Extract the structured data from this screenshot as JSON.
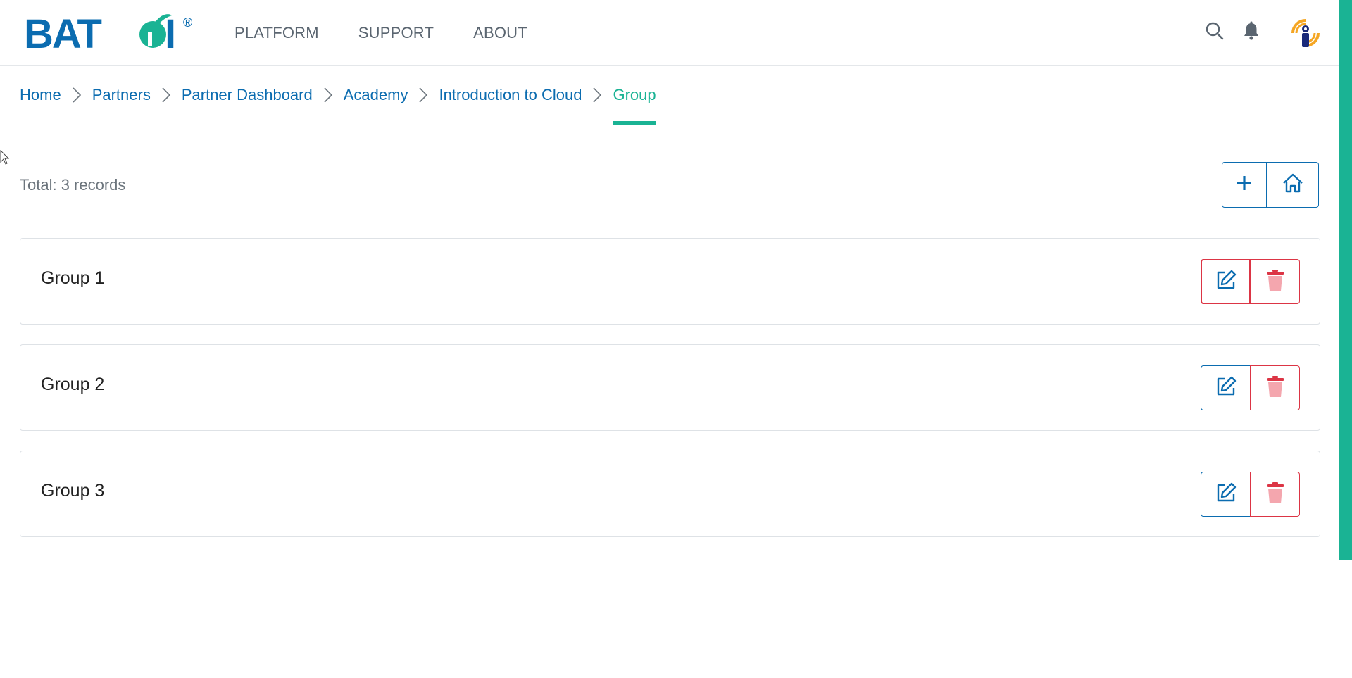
{
  "brand": {
    "logo_text": "BATOI",
    "registered_mark": "®",
    "primary_color": "#0b6cb0",
    "accent_color": "#1ab394",
    "danger_color": "#dc3545"
  },
  "nav": {
    "items": [
      {
        "label": "PLATFORM"
      },
      {
        "label": "SUPPORT"
      },
      {
        "label": "ABOUT"
      }
    ]
  },
  "header_icons": {
    "search": "search-icon",
    "notifications": "bell-icon",
    "avatar": "user-avatar"
  },
  "breadcrumb": {
    "items": [
      {
        "label": "Home"
      },
      {
        "label": "Partners"
      },
      {
        "label": "Partner Dashboard"
      },
      {
        "label": "Academy"
      },
      {
        "label": "Introduction to Cloud"
      },
      {
        "label": "Group"
      }
    ],
    "separator_icon": "chevron-right-icon"
  },
  "toolbar": {
    "total_text": "Total: 3 records",
    "add_icon": "plus-icon",
    "home_icon": "home-icon"
  },
  "groups": [
    {
      "name": "Group 1"
    },
    {
      "name": "Group 2"
    },
    {
      "name": "Group 3"
    }
  ]
}
